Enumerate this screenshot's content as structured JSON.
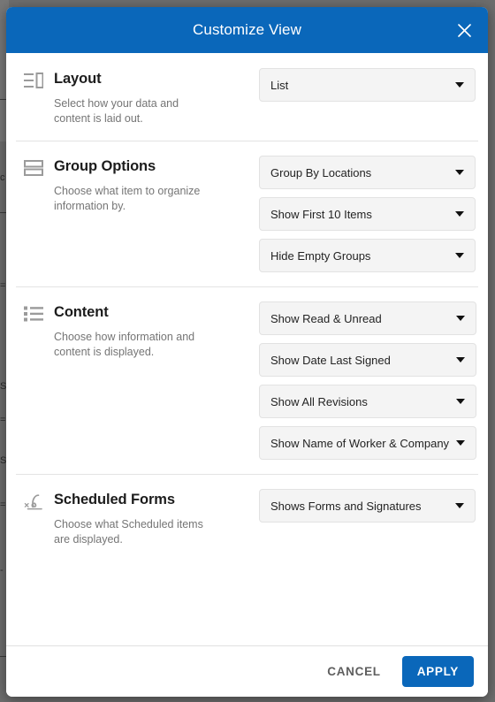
{
  "backdrop": {
    "color": "#6d6d6d",
    "fragments": [
      "c",
      "=",
      "S",
      "=",
      "S",
      "=",
      "-"
    ]
  },
  "dialog": {
    "header": {
      "title": "Customize View",
      "background": "#0a67ba",
      "close_icon": "close-icon"
    },
    "sections": [
      {
        "id": "layout",
        "icon": "layout-view-icon",
        "heading": "Layout",
        "description": "Select how your data and content is laid out.",
        "dropdowns": [
          {
            "id": "layout-style",
            "value": "List"
          }
        ]
      },
      {
        "id": "group-options",
        "icon": "group-rows-icon",
        "heading": "Group Options",
        "description": "Choose what item to organize information by.",
        "dropdowns": [
          {
            "id": "group-by",
            "value": "Group By Locations"
          },
          {
            "id": "item-count",
            "value": "Show First 10 Items"
          },
          {
            "id": "empty-groups",
            "value": "Hide Empty Groups"
          }
        ]
      },
      {
        "id": "content",
        "icon": "bulleted-list-icon",
        "heading": "Content",
        "description": "Choose how information and content is displayed.",
        "dropdowns": [
          {
            "id": "read-state",
            "value": "Show Read & Unread"
          },
          {
            "id": "date-display",
            "value": "Show Date Last Signed"
          },
          {
            "id": "revisions",
            "value": "Show All Revisions"
          },
          {
            "id": "name-display",
            "value": "Show Name of Worker & Company"
          }
        ]
      },
      {
        "id": "scheduled-forms",
        "icon": "signature-icon",
        "heading": "Scheduled Forms",
        "description": "Choose what Scheduled items are displayed.",
        "dropdowns": [
          {
            "id": "forms-display",
            "value": "Shows Forms and Signatures"
          }
        ]
      }
    ],
    "footer": {
      "cancel_label": "CANCEL",
      "apply_label": "APPLY",
      "apply_color": "#0a67ba"
    }
  }
}
